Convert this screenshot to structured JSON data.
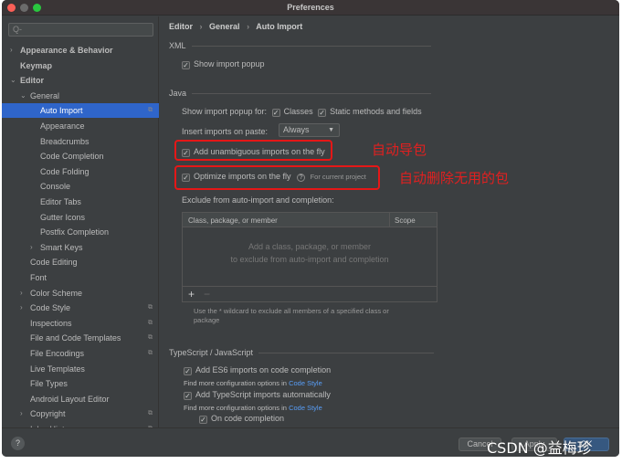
{
  "window": {
    "title": "Preferences"
  },
  "sidebar": {
    "search_placeholder": "Q-",
    "items": [
      {
        "label": "Appearance & Behavior",
        "level": 0,
        "arrow": "›",
        "bold": true
      },
      {
        "label": "Keymap",
        "level": 0,
        "bold": true
      },
      {
        "label": "Editor",
        "level": 0,
        "arrow": "⌄",
        "bold": true
      },
      {
        "label": "General",
        "level": 1,
        "arrow": "⌄"
      },
      {
        "label": "Auto Import",
        "level": 2,
        "selected": true,
        "copy": true
      },
      {
        "label": "Appearance",
        "level": 2
      },
      {
        "label": "Breadcrumbs",
        "level": 2
      },
      {
        "label": "Code Completion",
        "level": 2
      },
      {
        "label": "Code Folding",
        "level": 2
      },
      {
        "label": "Console",
        "level": 2
      },
      {
        "label": "Editor Tabs",
        "level": 2
      },
      {
        "label": "Gutter Icons",
        "level": 2
      },
      {
        "label": "Postfix Completion",
        "level": 2
      },
      {
        "label": "Smart Keys",
        "level": 2,
        "arrow": "›"
      },
      {
        "label": "Code Editing",
        "level": 1
      },
      {
        "label": "Font",
        "level": 1
      },
      {
        "label": "Color Scheme",
        "level": 1,
        "arrow": "›"
      },
      {
        "label": "Code Style",
        "level": 1,
        "arrow": "›",
        "copy": true
      },
      {
        "label": "Inspections",
        "level": 1,
        "copy": true
      },
      {
        "label": "File and Code Templates",
        "level": 1,
        "copy": true
      },
      {
        "label": "File Encodings",
        "level": 1,
        "copy": true
      },
      {
        "label": "Live Templates",
        "level": 1
      },
      {
        "label": "File Types",
        "level": 1
      },
      {
        "label": "Android Layout Editor",
        "level": 1
      },
      {
        "label": "Copyright",
        "level": 1,
        "arrow": "›",
        "copy": true
      },
      {
        "label": "Inlay Hints",
        "level": 1,
        "arrow": "›",
        "copy": true
      }
    ]
  },
  "breadcrumb": [
    "Editor",
    "General",
    "Auto Import"
  ],
  "xml": {
    "title": "XML",
    "show_popup": "Show import popup"
  },
  "java": {
    "title": "Java",
    "popup_for": "Show import popup for:",
    "classes": "Classes",
    "static": "Static methods and fields",
    "paste_label": "Insert imports on paste:",
    "paste_value": "Always",
    "add_unambiguous": "Add unambiguous imports on the fly",
    "optimize": "Optimize imports on the fly",
    "for_project": "For current project",
    "exclude_label": "Exclude from auto-import and completion:",
    "col1": "Class, package, or member",
    "col2": "Scope",
    "empty1": "Add a class, package, or member",
    "empty2": "to exclude from auto-import and completion",
    "hint1": "Use the * wildcard to exclude all members of a specified class or",
    "hint2": "package"
  },
  "annotations": {
    "auto_import": "自动导包",
    "auto_remove": "自动删除无用的包",
    "color": "#e02020"
  },
  "ts": {
    "title": "TypeScript / JavaScript",
    "es6": "Add ES6 imports on code completion",
    "find_more": "Find more configuration options in ",
    "code_style": "Code Style",
    "ts_auto": "Add TypeScript imports automatically",
    "on_completion": "On code completion"
  },
  "buttons": {
    "help": "?",
    "cancel": "Cancel",
    "apply": "Apply",
    "ok": "OK"
  },
  "watermark": "CSDN @益梅珍",
  "colors": {
    "selection": "#2f65ca",
    "link": "#589df6",
    "background": "#3c3f41"
  }
}
